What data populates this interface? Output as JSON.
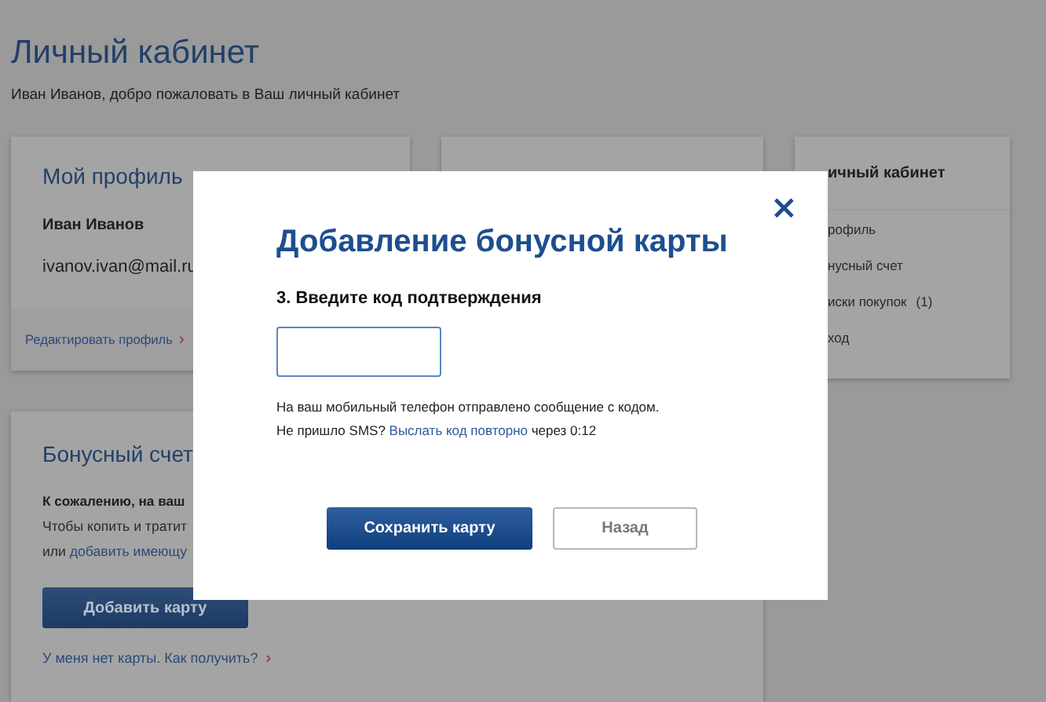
{
  "page": {
    "title": "Личный кабинет",
    "welcome": "Иван Иванов, добро пожаловать в Ваш личный кабинет"
  },
  "profile_card": {
    "title": "Мой профиль",
    "name": "Иван Иванов",
    "email": "ivanov.ivan@mail.ru",
    "edit_link": "Редактировать профиль",
    "link_arrow": "›"
  },
  "bonus_card": {
    "title": "Бонусный счет",
    "notice": "К сожалению, на ваш",
    "text_1": "Чтобы копить и тратит",
    "text_2_prefix": "или",
    "text_2_link": "добавить имеющу",
    "button": "Добавить карту",
    "help_link": "У меня нет карты. Как получить?",
    "help_arrow": "›"
  },
  "sidebar": {
    "title": "ичный кабинет",
    "items": [
      {
        "label": "рофиль"
      },
      {
        "label": "нусный счет"
      },
      {
        "label": "иски покупок",
        "count": "(1)"
      },
      {
        "label": "ход"
      }
    ]
  },
  "modal": {
    "close": "×",
    "title": "Добавление бонусной карты",
    "step_label": "3. Введите код подтверждения",
    "message": "На ваш мобильный телефон отправлено сообщение с кодом.",
    "resend_prompt": "Не пришло SMS?",
    "resend_link": "Выслать код повторно",
    "resend_timer": "через 0:12",
    "buttons": [
      {
        "label": "Сохранить карту",
        "kind": "primary"
      },
      {
        "label": "Назад",
        "kind": "secondary"
      }
    ]
  }
}
